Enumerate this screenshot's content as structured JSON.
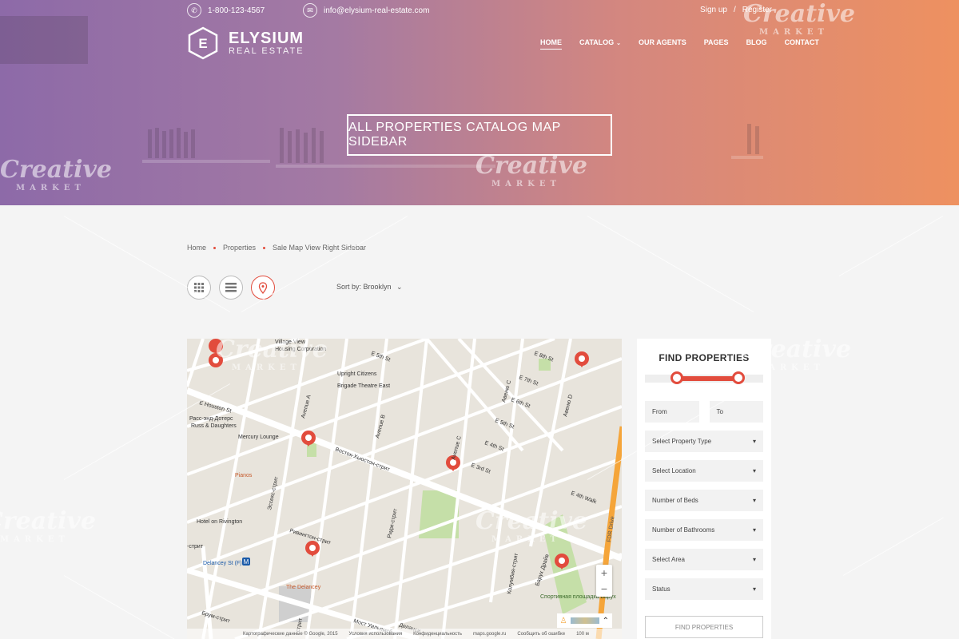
{
  "topbar": {
    "phone": "1-800-123-4567",
    "email": "info@elysium-real-estate.com",
    "sign_up": "Sign up",
    "separator": "/",
    "register": "Register"
  },
  "logo": {
    "letter": "E",
    "name": "ELYSIUM",
    "sub": "REAL ESTATE"
  },
  "nav": {
    "items": [
      {
        "label": "HOME",
        "active": true
      },
      {
        "label": "CATALOG",
        "dropdown": true
      },
      {
        "label": "OUR AGENTS"
      },
      {
        "label": "PAGES"
      },
      {
        "label": "BLOG"
      },
      {
        "label": "CONTACT"
      }
    ]
  },
  "hero": {
    "title": "ALL PROPERTIES CATALOG MAP SIDEBAR"
  },
  "breadcrumb": {
    "items": [
      "Home",
      "Properties",
      "Sale Map View Right Sidebar"
    ]
  },
  "sort": {
    "label": "Sort by: Brooklyn"
  },
  "views": {
    "icons": [
      "grid-icon",
      "list-icon",
      "map-pin-icon"
    ],
    "active": "map-pin-icon"
  },
  "map": {
    "labels": {
      "village_view": "Village View",
      "housing_corp": "Housing Corporation",
      "e5th": "E 5th St",
      "e8th": "E 8th St",
      "e7th": "E 7th St",
      "e6th": "E 6th St",
      "e5th2": "E 5th St",
      "e4th": "E 4th St",
      "e3rd": "E 3rd St",
      "upright": "Upright Citizens",
      "brigade": "Brigade Theatre East",
      "e_houston": "E Houston St",
      "russ1": "Расс-энд-Дотерс",
      "russ2": "Russ & Daughters",
      "mercury": "Mercury Lounge",
      "pianos": "Pianos",
      "hotel": "Hotel on Rivington",
      "delancey_st": "Delancey St (F)",
      "the_delancey": "The Delancey",
      "avenue_a": "Avenue A",
      "avenue_b": "Avenue B",
      "avenue_c": "Avenue C",
      "avenue_c2": "Авеню C",
      "avenue_d": "Авеню D",
      "houston_ru": "Восток-Хьюстон-стрит",
      "essex": "Эссекс-стрит",
      "rivington": "Ривингтон-стрит",
      "ridge": "Ридж-стрит",
      "columbia": "Колумбия-стрит",
      "baruch": "Барух Драйв",
      "park": "Спортивная площадка Барух",
      "fdr": "FDR Drive",
      "e4th_walk": "E 4th Walk",
      "brum": "Брум-стрит",
      "delancey_ru": "Деланси",
      "most": "Мост Уильямсб",
      "strit": "-стрит",
      "ludlow": "-стрит",
      "metro": "M"
    },
    "footer": [
      "Картографические данные © Google, 2015",
      "Условия использования",
      "Конфиденциальность",
      "maps.google.ru",
      "Сообщить об ошибке",
      "100 м"
    ],
    "markers_count": 7
  },
  "sidebar": {
    "title": "FIND PROPERTIES",
    "from": "From",
    "to": "To",
    "selects": [
      "Select Property Type",
      "Select Location",
      "Number of Beds",
      "Number of Bathrooms",
      "Select Area",
      "Status"
    ],
    "button": "FIND PROPERTIES"
  },
  "watermark": {
    "brand": "Creative",
    "sub": "MARKET"
  },
  "colors": {
    "accent": "#e24c3d",
    "hero_left": "#8d6aa8",
    "hero_right": "#ee9160"
  }
}
